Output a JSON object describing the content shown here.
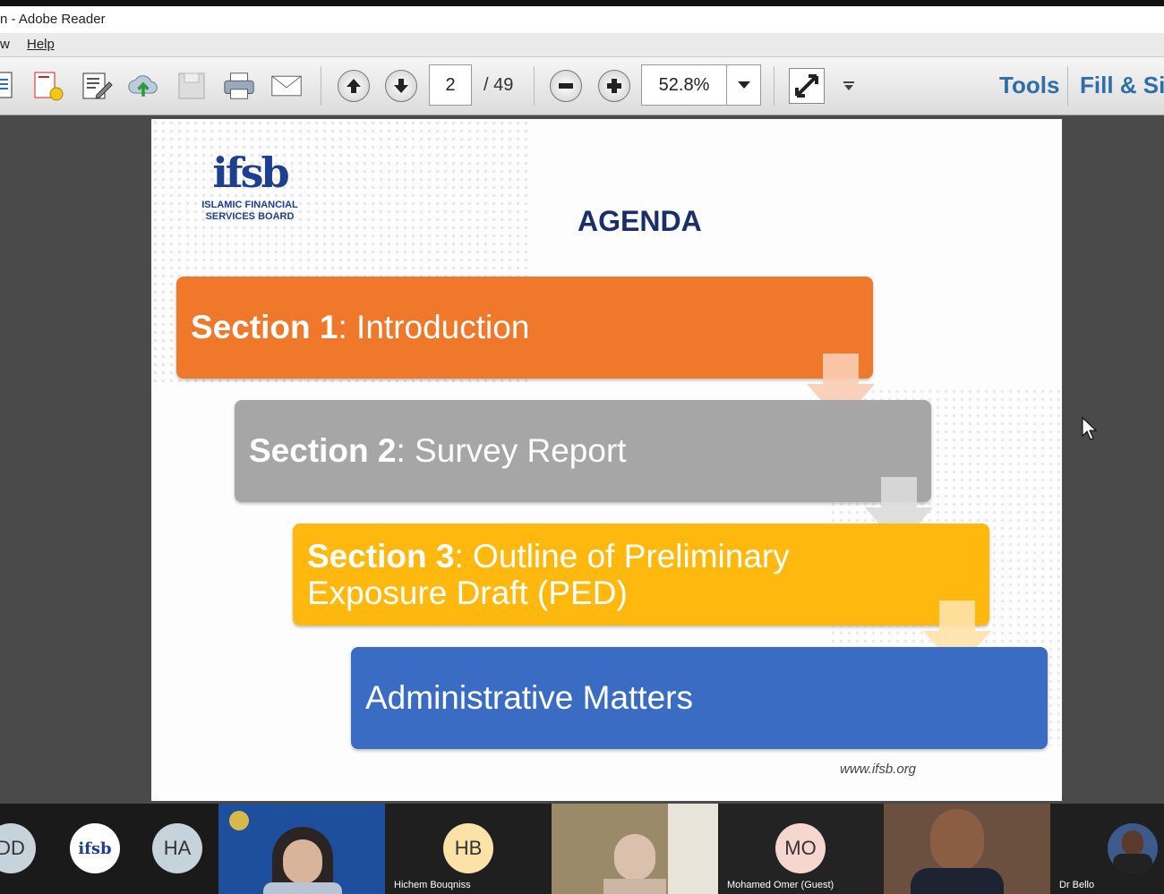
{
  "window": {
    "title": "n - Adobe Reader"
  },
  "menu": {
    "items": [
      "w",
      "Help"
    ]
  },
  "toolbar": {
    "page_current": "2",
    "page_total": "/ 49",
    "zoom": "52.8%",
    "tools_label": "Tools",
    "fill_label": "Fill & Si"
  },
  "slide": {
    "logo_text_line1": "ISLAMIC FINANCIAL",
    "logo_text_line2": "SERVICES BOARD",
    "logo_mark": "ifsb",
    "title": "AGENDA",
    "sections": [
      {
        "bold": "Section 1",
        "text": ": Introduction",
        "color": "#f0782a"
      },
      {
        "bold": "Section 2",
        "text": ": Survey Report",
        "color": "#a6a6a6"
      },
      {
        "bold": "Section 3",
        "text": ": Outline of Preliminary",
        "text2": "Exposure Draft (PED)",
        "color": "#ffb80d"
      },
      {
        "bold": "",
        "text": "Administrative Matters",
        "color": "#3a6cc4"
      }
    ],
    "url": "www.ifsb.org"
  },
  "participants": [
    {
      "initials": "DD"
    },
    {
      "initials": "ifsb"
    },
    {
      "initials": "HA"
    },
    {
      "initials": ""
    },
    {
      "initials": "HB",
      "name": "Hichem Bouqniss"
    },
    {
      "initials": ""
    },
    {
      "initials": "MO",
      "name": "Mohamed Omer (Guest)"
    },
    {
      "initials": ""
    },
    {
      "initials": "",
      "name": "Dr Bello"
    }
  ]
}
